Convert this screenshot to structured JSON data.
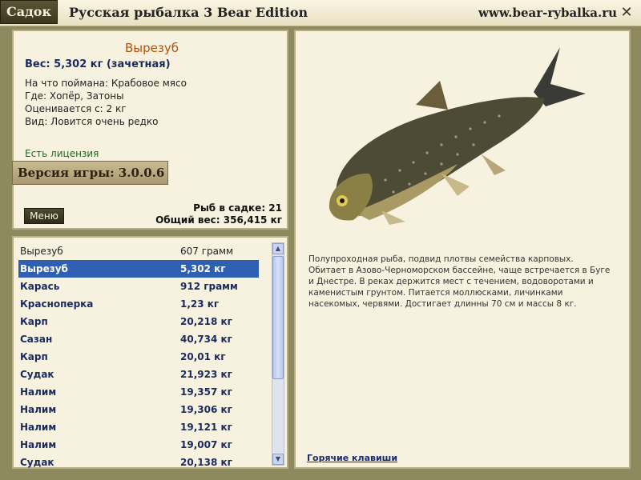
{
  "titlebar": {
    "tab_label": "Садок",
    "title": "Русская рыбалка 3 Bear Edition",
    "url": "www.bear-rybalka.ru",
    "close": "✕"
  },
  "catch": {
    "name": "Вырезуб",
    "weight": "Вес: 5,302 кг (зачетная)",
    "bait": "На что поймана: Крабовое мясо",
    "place": "Где: Хопёр, Затоны",
    "valued_from": "Оценивается с: 2 кг",
    "kind": "Вид: Ловится очень редко",
    "license": "Есть лицензия",
    "version": "Версия игры: 3.0.0.6",
    "menu_label": "Меню",
    "fish_count": "Рыб в садке: 21",
    "total_weight": "Общий вес: 356,415 кг"
  },
  "fish_list": [
    {
      "name": "Вырезуб",
      "weight": "607 грамм",
      "style": "plain"
    },
    {
      "name": "Вырезуб",
      "weight": "5,302 кг",
      "style": "selected"
    },
    {
      "name": "Карась",
      "weight": "912 грамм",
      "style": ""
    },
    {
      "name": "Красноперка",
      "weight": "1,23 кг",
      "style": ""
    },
    {
      "name": "Карп",
      "weight": "20,218 кг",
      "style": ""
    },
    {
      "name": "Сазан",
      "weight": "40,734 кг",
      "style": ""
    },
    {
      "name": "Карп",
      "weight": "20,01 кг",
      "style": ""
    },
    {
      "name": "Судак",
      "weight": "21,923 кг",
      "style": ""
    },
    {
      "name": "Налим",
      "weight": "19,357 кг",
      "style": ""
    },
    {
      "name": "Налим",
      "weight": "19,306 кг",
      "style": ""
    },
    {
      "name": "Налим",
      "weight": "19,121 кг",
      "style": ""
    },
    {
      "name": "Налим",
      "weight": "19,007 кг",
      "style": ""
    },
    {
      "name": "Судак",
      "weight": "20,138 кг",
      "style": ""
    }
  ],
  "description": "Полупроходная рыба, подвид плотвы семейства карповых. Обитает в Азово-Черноморском бассейне, чаще встречается в Буге и Днестре. В реках держится мест с течением, водоворотами и каменистым грунтом. Питается моллюсками, личинками насекомых, червями. Достигает длинны 70 см и массы 8 кг.",
  "hotkeys_label": "Горячие клавиши",
  "icons": {
    "close": "close-icon",
    "scroll_up": "arrow-up-icon",
    "scroll_down": "arrow-down-icon"
  }
}
